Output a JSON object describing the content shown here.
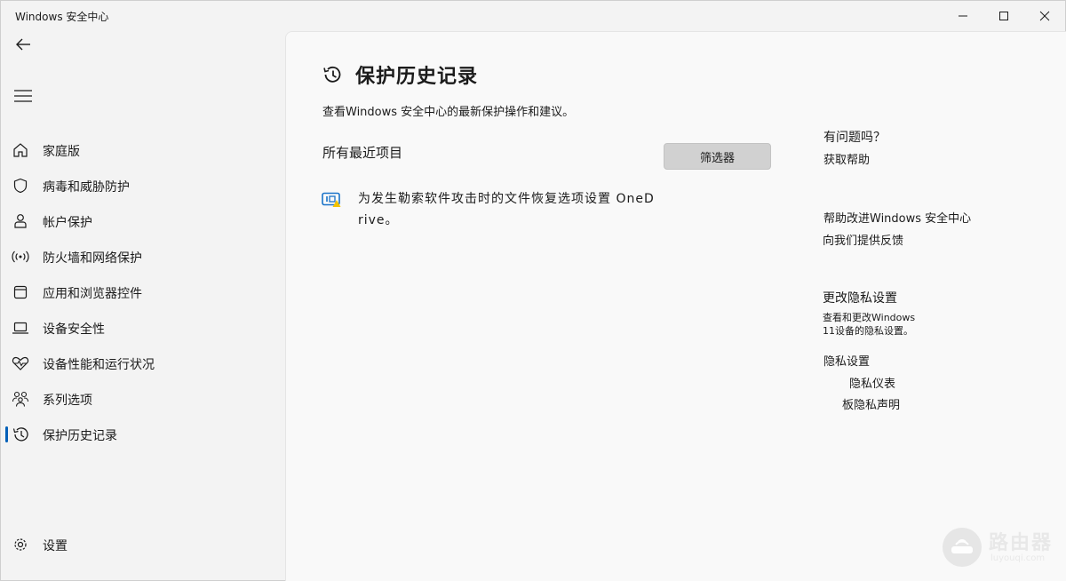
{
  "window": {
    "title": "Windows 安全中心"
  },
  "sidebar": {
    "items": [
      {
        "label": "家庭版",
        "icon": "home-icon"
      },
      {
        "label": "病毒和威胁防护",
        "icon": "shield-icon"
      },
      {
        "label": "帐户保护",
        "icon": "person-icon"
      },
      {
        "label": "防火墙和网络保护",
        "icon": "wifi-broadcast-icon"
      },
      {
        "label": "应用和浏览器控件",
        "icon": "app-window-icon"
      },
      {
        "label": "设备安全性",
        "icon": "laptop-icon"
      },
      {
        "label": "设备性能和运行状况",
        "icon": "heartbeat-icon"
      },
      {
        "label": "系列选项",
        "icon": "family-icon"
      },
      {
        "label": "保护历史记录",
        "icon": "history-icon",
        "active": true
      }
    ],
    "settings_label": "设置"
  },
  "main": {
    "title": "保护历史记录",
    "subtitle": "查看Windows 安全中心的最新保护操作和建议。",
    "section_heading": "所有最近项目",
    "filter_label": "筛选器",
    "history_item": "为发生勒索软件攻击时的文件恢复选项设置 OneDrive。"
  },
  "side_panel": {
    "question_heading": "有问题吗？",
    "get_help": "获取帮助",
    "improve_heading": "帮助改进Windows 安全中心",
    "feedback": "向我们提供反馈",
    "privacy_heading": "更改隐私设置",
    "privacy_desc_line1": "查看和更改Windows",
    "privacy_desc_line2": "11设备的隐私设置。",
    "privacy_settings": "隐私设置",
    "privacy_dashboard": "隐私仪表",
    "privacy_statement": "板隐私声明"
  },
  "watermark": {
    "name": "路由器",
    "url": "luyouqi.com"
  },
  "colors": {
    "accent": "#005fb8",
    "sidebar_bg": "#f3f3f3",
    "content_bg": "#f9f9f9",
    "filter_button_bg": "#d1d1d1",
    "alert_icon_blue": "#1a73c9",
    "alert_icon_yellow": "#f2c200"
  }
}
